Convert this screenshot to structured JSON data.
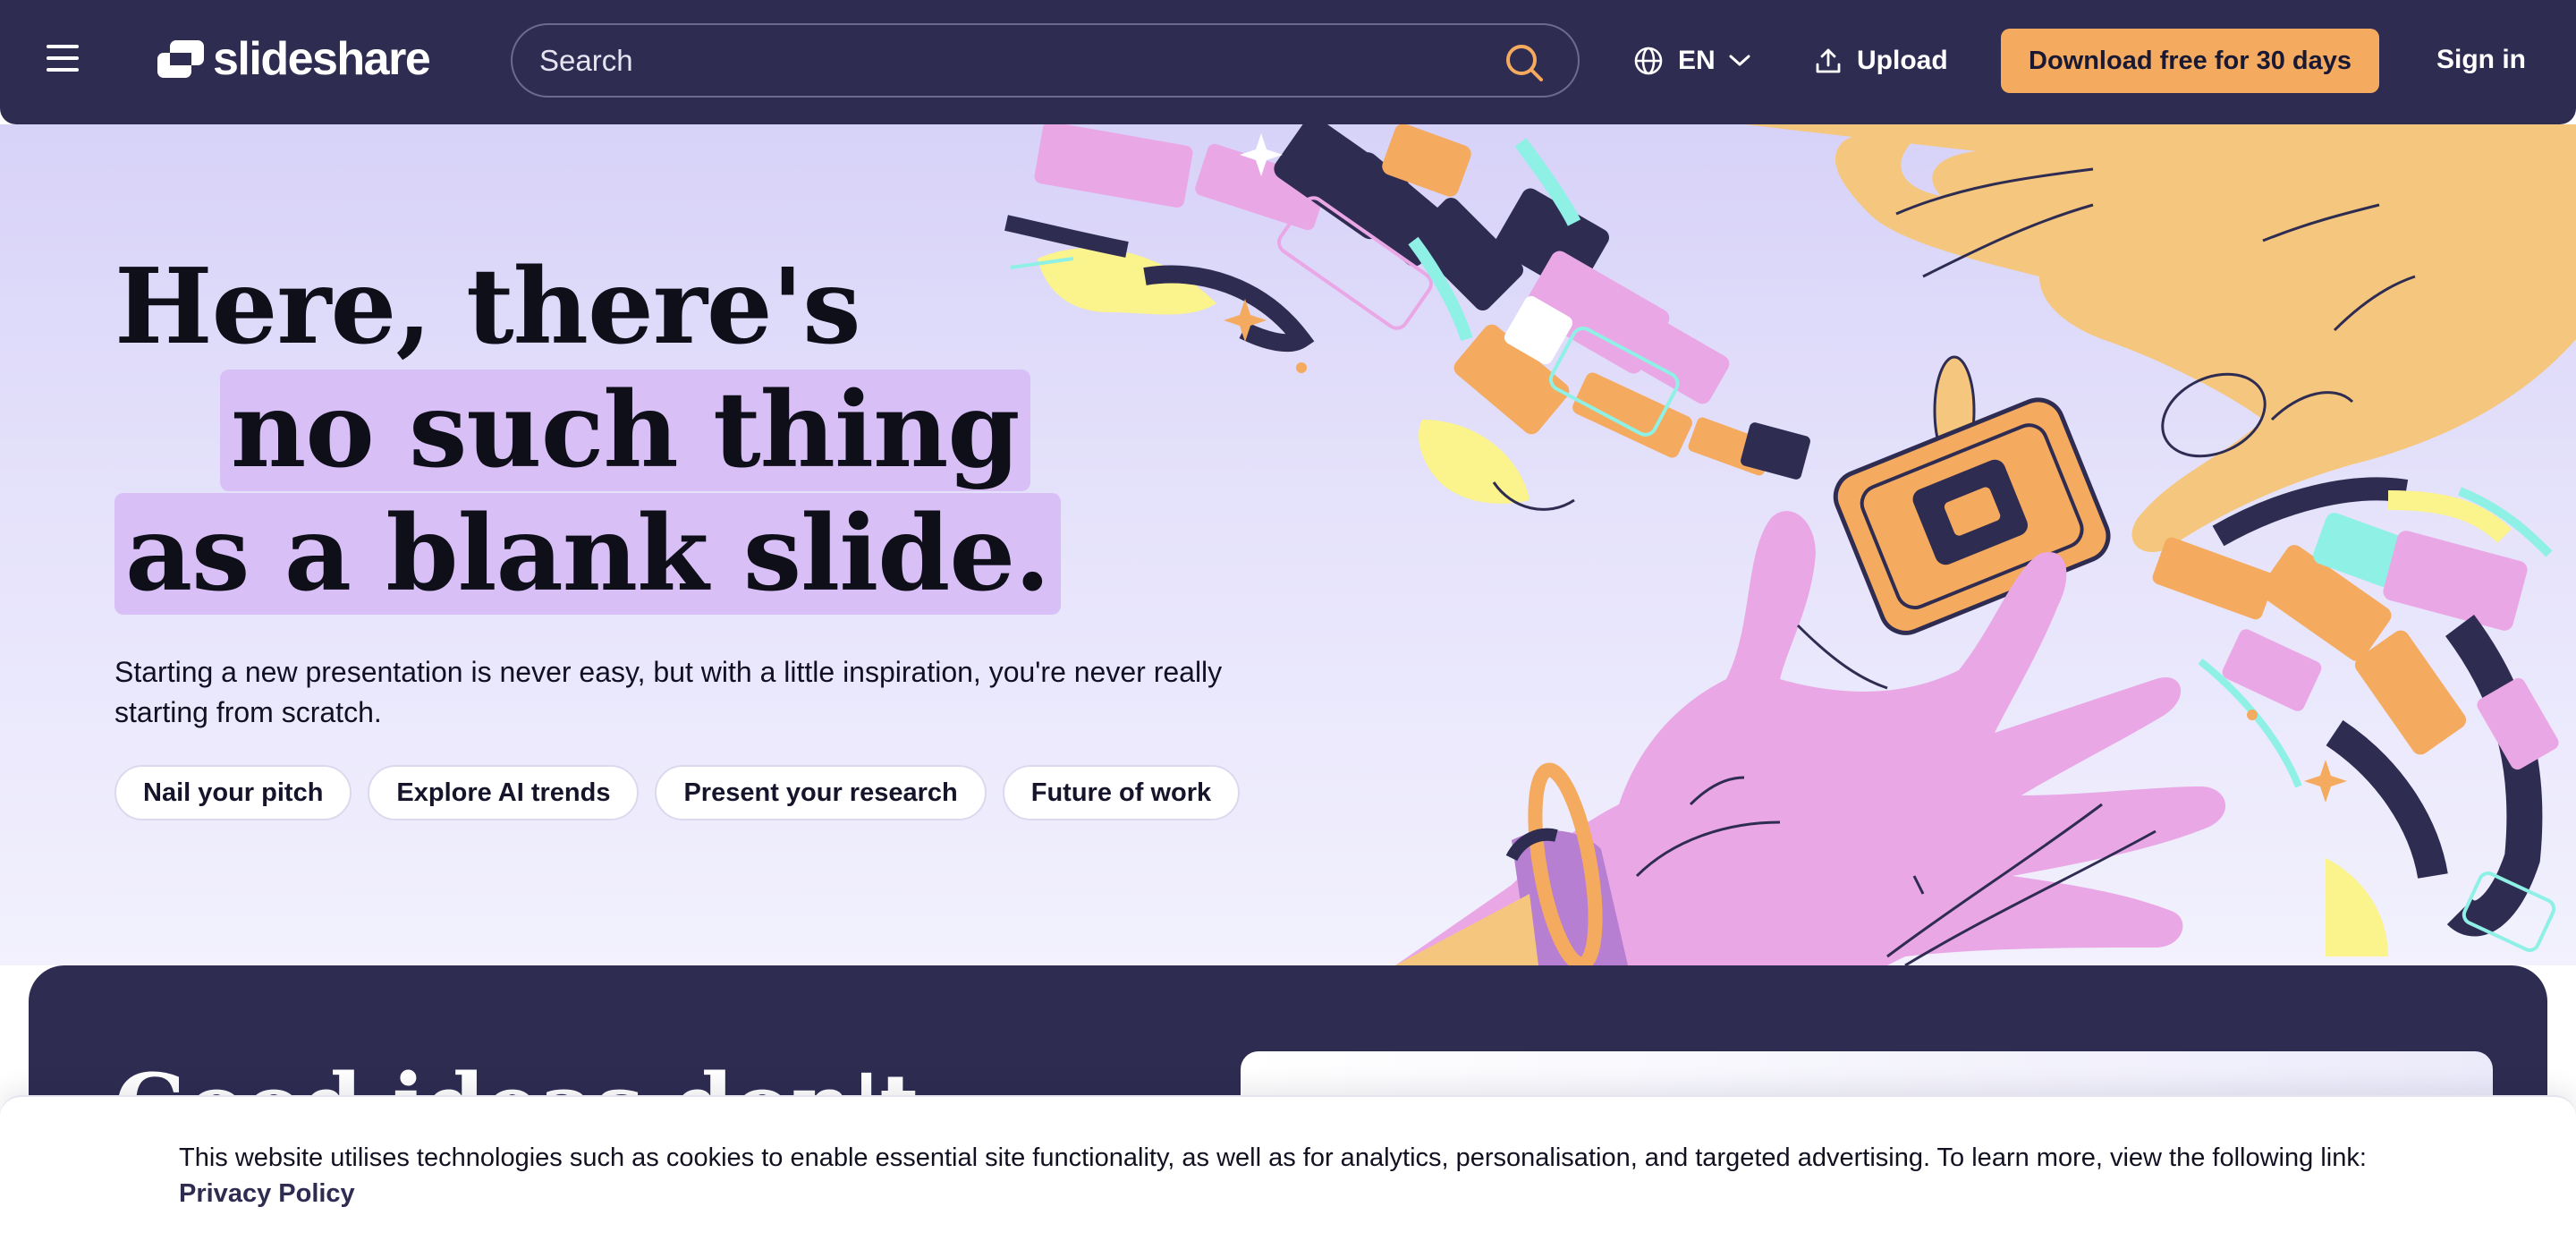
{
  "header": {
    "logo_text": "slideshare",
    "search_placeholder": "Search",
    "language_label": "EN",
    "upload_label": "Upload",
    "download_label": "Download free for 30 days",
    "signin_label": "Sign in",
    "icons": [
      "menu-icon",
      "slideshare-logo-icon",
      "search-icon",
      "globe-icon",
      "chevron-down-icon",
      "upload-icon"
    ]
  },
  "hero": {
    "headline_line1": "Here, there's",
    "headline_line2": "no such thing",
    "headline_line3": "as a blank slide.",
    "subtitle": "Starting a new presentation is never easy, but with a little inspiration, you're never really starting from scratch.",
    "chips": [
      "Nail your pitch",
      "Explore AI trends",
      "Present your research",
      "Future of work"
    ]
  },
  "section": {
    "title": "Good ideas don't"
  },
  "cookie_banner": {
    "text": "This website utilises technologies such as cookies to enable essential site functionality, as well as for analytics, personalisation, and targeted advertising. To learn more, view the following link: ",
    "link_label": "Privacy Policy"
  },
  "colors": {
    "header_bg": "#2f2c52",
    "accent_orange": "#f4aa5f",
    "highlight_lilac": "#d8bff6",
    "hero_bg": "#e5e2fb"
  }
}
